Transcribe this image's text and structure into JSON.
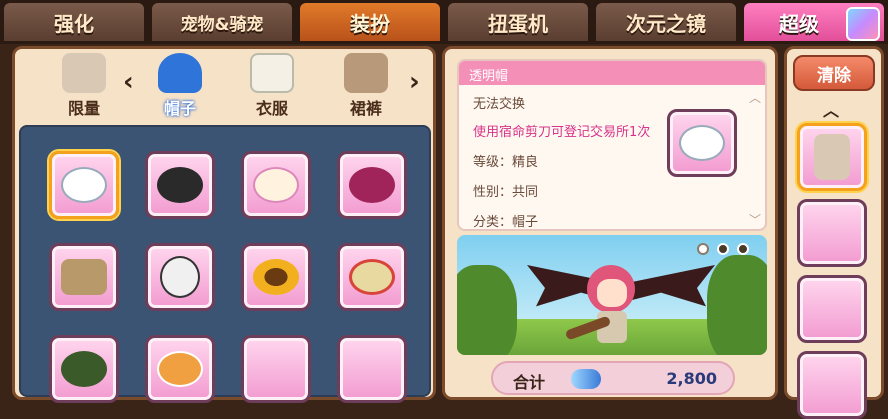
{
  "tabs": [
    {
      "label": "强化",
      "state": "normal"
    },
    {
      "label": "宠物&骑宠",
      "state": "normal"
    },
    {
      "label": "装扮",
      "state": "active"
    },
    {
      "label": "扭蛋机",
      "state": "normal"
    },
    {
      "label": "次元之镜",
      "state": "normal"
    },
    {
      "label": "超级",
      "state": "pink"
    }
  ],
  "categories": [
    {
      "label": "限量",
      "icon": "outfit-icon"
    },
    {
      "label": "帽子",
      "icon": "blue-cap-icon"
    },
    {
      "label": "衣服",
      "icon": "shirt-icon"
    },
    {
      "label": "裙裤",
      "icon": "shorts-icon"
    }
  ],
  "items": [
    {
      "icon": "white-cap-icon",
      "color": "#ffffff"
    },
    {
      "icon": "officer-hat-icon",
      "color": "#2a2a2a"
    },
    {
      "icon": "flower-bonnet-icon",
      "color": "#fff3e0"
    },
    {
      "icon": "heart-helmet-icon",
      "color": "#a0245a"
    },
    {
      "icon": "straw-cap-icon",
      "color": "#b89a6a"
    },
    {
      "icon": "skull-mask-icon",
      "color": "#f0f0f0"
    },
    {
      "icon": "sunflower-icon",
      "color": "#f2b01e"
    },
    {
      "icon": "sun-hat-icon",
      "color": "#e8d9a0"
    },
    {
      "icon": "star-cap-icon",
      "color": "#3a5a2a"
    },
    {
      "icon": "tiger-cap-icon",
      "color": "#f0a040"
    },
    {
      "icon": "empty-slot",
      "color": ""
    },
    {
      "icon": "empty-slot",
      "color": ""
    }
  ],
  "detail": {
    "name": "透明帽",
    "trade": "无法交换",
    "note": "使用宿命剪刀可登记交易所1次",
    "grade": "等级：精良",
    "gender": "性别：共同",
    "category": "分类：帽子"
  },
  "total": {
    "label": "合计",
    "amount": "2,800"
  },
  "cart": {
    "clear_label": "清除"
  }
}
